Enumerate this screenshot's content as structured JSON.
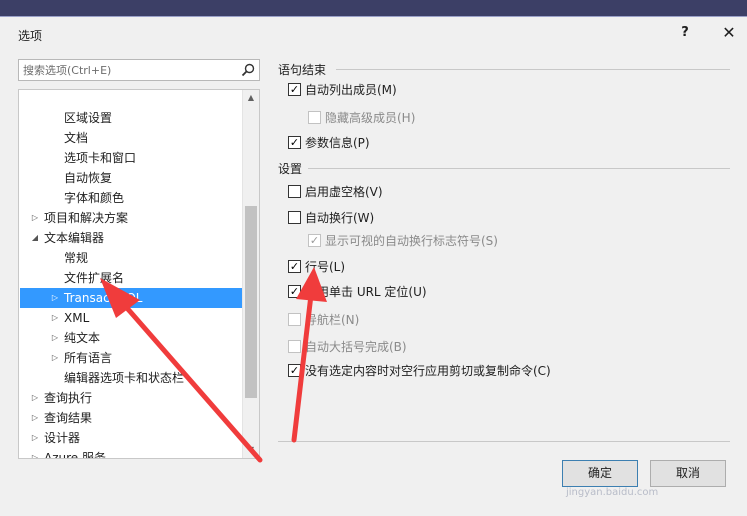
{
  "dialog": {
    "title": "选项",
    "help": "?",
    "close": "✕"
  },
  "search": {
    "placeholder": "搜索选项(Ctrl+E)"
  },
  "tree": {
    "items": [
      {
        "label": "区域设置",
        "arrow": ""
      },
      {
        "label": "文档",
        "arrow": ""
      },
      {
        "label": "选项卡和窗口",
        "arrow": ""
      },
      {
        "label": "自动恢复",
        "arrow": ""
      },
      {
        "label": "字体和颜色",
        "arrow": ""
      },
      {
        "label": "项目和解决方案",
        "arrow": "▷"
      },
      {
        "label": "文本编辑器",
        "arrow": "◢"
      },
      {
        "label": "常规",
        "arrow": ""
      },
      {
        "label": "文件扩展名",
        "arrow": ""
      },
      {
        "label": "Transact-SQL",
        "arrow": "▷"
      },
      {
        "label": "XML",
        "arrow": "▷"
      },
      {
        "label": "纯文本",
        "arrow": "▷"
      },
      {
        "label": "所有语言",
        "arrow": "▷"
      },
      {
        "label": "编辑器选项卡和状态栏",
        "arrow": ""
      },
      {
        "label": "查询执行",
        "arrow": "▷"
      },
      {
        "label": "查询结果",
        "arrow": "▷"
      },
      {
        "label": "设计器",
        "arrow": "▷"
      },
      {
        "label": "Azure 服务",
        "arrow": "▷"
      }
    ],
    "scroll_up": "▲",
    "scroll_down": "▼"
  },
  "statement_completion": {
    "header": "语句结束",
    "options": [
      {
        "label": "自动列出成员(M)",
        "checked": true,
        "disabled": false
      },
      {
        "label": "隐藏高级成员(H)",
        "checked": false,
        "disabled": true
      },
      {
        "label": "参数信息(P)",
        "checked": true,
        "disabled": false
      }
    ]
  },
  "settings": {
    "header": "设置",
    "options": [
      {
        "label": "启用虚空格(V)",
        "checked": false,
        "disabled": false
      },
      {
        "label": "自动换行(W)",
        "checked": false,
        "disabled": false
      },
      {
        "label": "显示可视的自动换行标志符号(S)",
        "checked": true,
        "disabled": true
      },
      {
        "label": "行号(L)",
        "checked": true,
        "disabled": false
      },
      {
        "label": "启用单击 URL 定位(U)",
        "checked": true,
        "disabled": false
      },
      {
        "label": "导航栏(N)",
        "checked": false,
        "disabled": true
      },
      {
        "label": "自动大括号完成(B)",
        "checked": false,
        "disabled": true
      },
      {
        "label": "没有选定内容时对空行应用剪切或复制命令(C)",
        "checked": true,
        "disabled": false
      }
    ]
  },
  "buttons": {
    "ok": "确定",
    "cancel": "取消"
  },
  "watermark": "jingyan.baidu.com",
  "colors": {
    "selection": "#3399ff",
    "annotation_arrow": "#f03c3c",
    "backdrop": "#3c3f66"
  }
}
